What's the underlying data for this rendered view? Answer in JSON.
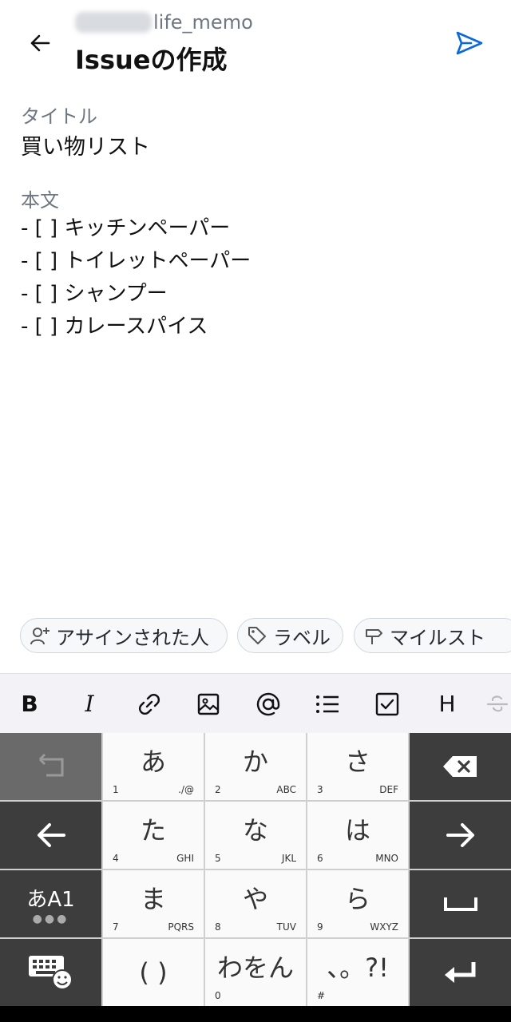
{
  "header": {
    "repo_name": "life_memo",
    "title": "Issueの作成",
    "back_icon": "arrow-left-icon",
    "send_icon": "paper-plane-icon",
    "accent_color": "#0969da"
  },
  "form": {
    "title_label": "タイトル",
    "title_value": "買い物リスト",
    "body_label": "本文",
    "body_lines": [
      "- [ ] キッチンペーパー",
      "- [ ] トイレットペーパー",
      "- [ ] シャンプー",
      "- [ ] カレースパイス"
    ]
  },
  "chips": [
    {
      "label": "アサインされた人",
      "icon": "person-add-icon"
    },
    {
      "label": "ラベル",
      "icon": "tag-icon"
    },
    {
      "label": "マイルスト",
      "icon": "milestone-icon"
    }
  ],
  "toolbar": {
    "bold": "B",
    "italic": "I",
    "heading": "H"
  },
  "keyboard": {
    "keys": [
      {
        "kana": "あ",
        "num": "1",
        "sub": "./@"
      },
      {
        "kana": "か",
        "num": "2",
        "sub": "ABC"
      },
      {
        "kana": "さ",
        "num": "3",
        "sub": "DEF"
      },
      {
        "kana": "た",
        "num": "4",
        "sub": "GHI"
      },
      {
        "kana": "な",
        "num": "5",
        "sub": "JKL"
      },
      {
        "kana": "は",
        "num": "6",
        "sub": "MNO"
      },
      {
        "kana": "ま",
        "num": "7",
        "sub": "PQRS"
      },
      {
        "kana": "や",
        "num": "8",
        "sub": "TUV"
      },
      {
        "kana": "ら",
        "num": "9",
        "sub": "WXYZ"
      },
      {
        "kana": "( )",
        "num": "",
        "sub": ""
      },
      {
        "kana": "わをん",
        "num": "0",
        "sub": ""
      },
      {
        "kana": "、。?!",
        "num": "#",
        "sub": ""
      }
    ],
    "mode_label": "あA1"
  }
}
